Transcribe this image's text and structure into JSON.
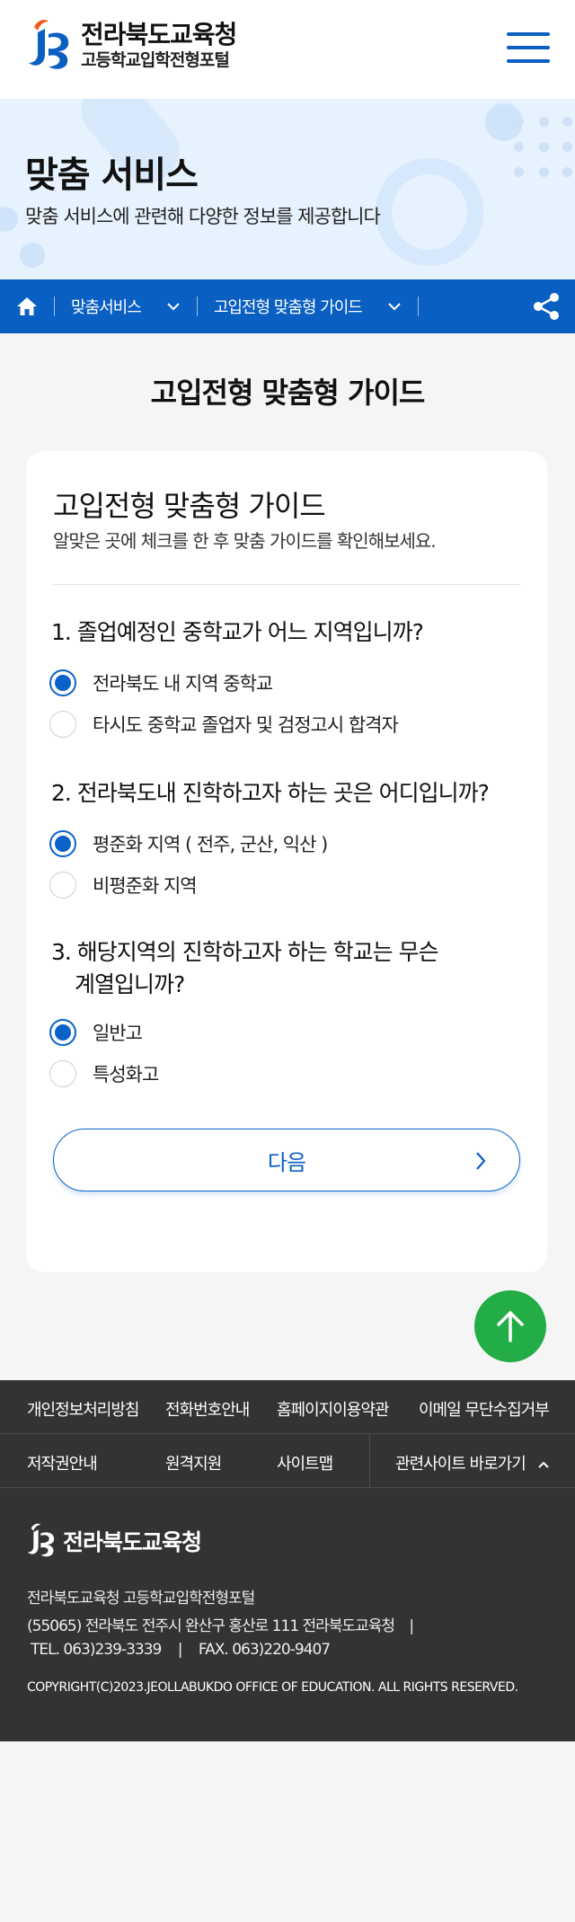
{
  "header": {
    "logo_title": "전라북도교육청",
    "logo_subtitle": "고등학교입학전형포털",
    "menu_icon": "hamburger-menu-icon"
  },
  "hero": {
    "title": "맞춤 서비스",
    "description": "맞춤 서비스에 관련해 다양한 정보를 제공합니다"
  },
  "breadcrumb": {
    "home_icon": "home-icon",
    "items": [
      {
        "label": "맞춤서비스"
      },
      {
        "label": "고입전형 맞춤형 가이드"
      }
    ],
    "share_icon": "share-icon"
  },
  "page_title": "고입전형 맞춤형 가이드",
  "guide": {
    "title": "고입전형 맞춤형 가이드",
    "description": "알맞은 곳에 체크를 한 후 맞춤 가이드를 확인해보세요.",
    "questions": [
      {
        "label": "1. 졸업예정인 중학교가 어느 지역입니까?",
        "options": [
          {
            "label": "전라북도 내 지역 중학교",
            "checked": true
          },
          {
            "label": "타시도 중학교 졸업자 및 검정고시 합격자",
            "checked": false
          }
        ]
      },
      {
        "label": "2. 전라북도내 진학하고자 하는 곳은 어디입니까?",
        "options": [
          {
            "label": "평준화 지역 ( 전주, 군산, 익산 )",
            "checked": true
          },
          {
            "label": "비평준화 지역",
            "checked": false
          }
        ]
      },
      {
        "label_line1": "3. 해당지역의 진학하고자 하는 학교는 무슨",
        "label_line2": "계열입니까?",
        "options": [
          {
            "label": "일반고",
            "checked": true
          },
          {
            "label": "특성화고",
            "checked": false
          }
        ]
      }
    ],
    "next_label": "다음"
  },
  "footer": {
    "links_row1": [
      "개인정보처리방침",
      "전화번호안내",
      "홈페이지이용약관",
      "이메일 무단수집거부"
    ],
    "links_row2": [
      "저작권안내",
      "원격지원",
      "사이트맵",
      "관련사이트 바로가기"
    ],
    "logo_text": "전라북도교육청",
    "org_name": "전라북도교육청 고등학교입학전형포털",
    "address": "(55065) 전라북도 전주시 완산구 홍산로 111 전라북도교육청",
    "tel": "TEL. 063)239-3339",
    "fax": "FAX. 063)220-9407",
    "copyright": "COPYRIGHT(C)2023.JEOLLABUKDO OFFICE OF EDUCATION. ALL RIGHTS RESERVED."
  },
  "colors": {
    "brand_blue": "#0a5fc2",
    "hero_bg": "#e6f2fd",
    "top_button": "#22ad47",
    "footer_bg": "#333333",
    "logo_orange": "#f05a22"
  }
}
